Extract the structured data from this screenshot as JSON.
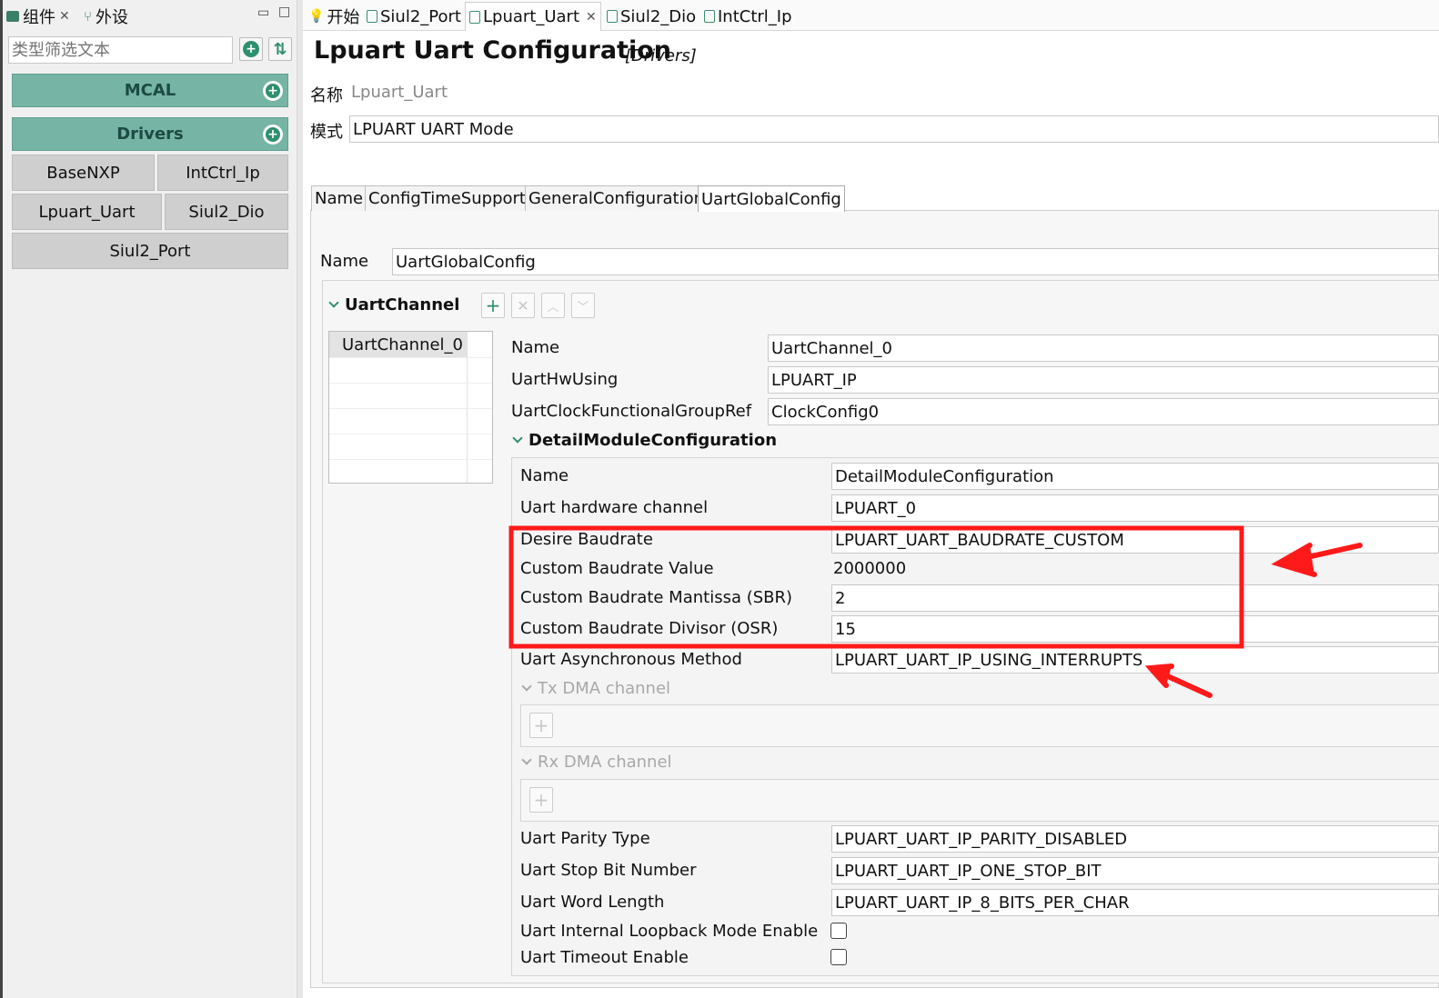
{
  "left": {
    "tabs": [
      {
        "label": "组件",
        "icon": "component-icon"
      },
      {
        "label": "外设",
        "icon": "peripheral-icon"
      }
    ],
    "filter_placeholder": "类型筛选文本",
    "groups": {
      "mcal": "MCAL",
      "drivers": "Drivers"
    },
    "buttons": [
      "BaseNXP",
      "IntCtrl_Ip",
      "Lpuart_Uart",
      "Siul2_Dio",
      "Siul2_Port"
    ]
  },
  "editor": {
    "tabs": [
      "开始",
      "Siul2_Port",
      "Lpuart_Uart",
      "Siul2_Dio",
      "IntCtrl_Ip"
    ],
    "title": "Lpuart Uart Configuration",
    "subtitle": "[Drivers]",
    "name_label": "名称",
    "name_value": "Lpuart_Uart",
    "mode_label": "模式",
    "mode_value": "LPUART UART Mode",
    "section_tabs": [
      "Name",
      "ConfigTimeSupport",
      "GeneralConfiguration",
      "UartGlobalConfig"
    ],
    "global": {
      "name_label": "Name",
      "name_value": "UartGlobalConfig"
    },
    "channel": {
      "header": "UartChannel",
      "list": [
        "UartChannel_0"
      ],
      "fields": [
        {
          "label": "Name",
          "value": "UartChannel_0"
        },
        {
          "label": "UartHwUsing",
          "value": "LPUART_IP"
        },
        {
          "label": "UartClockFunctionalGroupRef",
          "value": "ClockConfig0"
        }
      ]
    },
    "detail": {
      "header": "DetailModuleConfiguration",
      "fields": [
        {
          "label": "Name",
          "value": "DetailModuleConfiguration"
        },
        {
          "label": "Uart hardware channel",
          "value": "LPUART_0"
        },
        {
          "label": "Desire Baudrate",
          "value": "LPUART_UART_BAUDRATE_CUSTOM"
        },
        {
          "label": "Custom Baudrate Value",
          "value": "2000000"
        },
        {
          "label": "Custom Baudrate Mantissa (SBR)",
          "value": "2"
        },
        {
          "label": "Custom Baudrate Divisor (OSR)",
          "value": "15"
        },
        {
          "label": "Uart Asynchronous Method",
          "value": "LPUART_UART_IP_USING_INTERRUPTS"
        }
      ],
      "tx_dma": "Tx DMA channel",
      "rx_dma": "Rx DMA channel",
      "fields2": [
        {
          "label": "Uart Parity Type",
          "value": "LPUART_UART_IP_PARITY_DISABLED"
        },
        {
          "label": "Uart Stop Bit Number",
          "value": "LPUART_UART_IP_ONE_STOP_BIT"
        },
        {
          "label": "Uart Word Length",
          "value": "LPUART_UART_IP_8_BITS_PER_CHAR"
        }
      ],
      "checkboxes": [
        {
          "label": "Uart Internal Loopback Mode Enable",
          "checked": false
        },
        {
          "label": "Uart Timeout Enable",
          "checked": false
        }
      ]
    }
  },
  "colors": {
    "accent": "#76b5a5",
    "highlight": "#ff1a1a"
  }
}
